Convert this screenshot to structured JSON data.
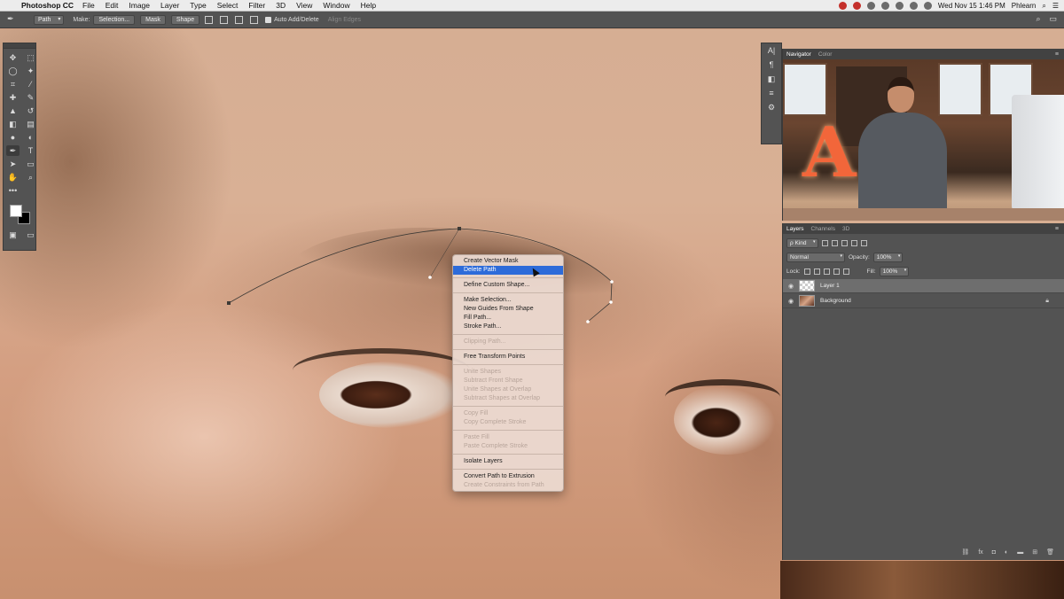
{
  "menubar": {
    "app_name": "Photoshop CC",
    "menus": [
      "File",
      "Edit",
      "Image",
      "Layer",
      "Type",
      "Select",
      "Filter",
      "3D",
      "View",
      "Window",
      "Help"
    ],
    "clock": "Wed Nov 15  1:46 PM",
    "user": "Phlearn"
  },
  "options_bar": {
    "mode": "Path",
    "make_label": "Make:",
    "selection_btn": "Selection...",
    "mask_btn": "Mask",
    "shape_btn": "Shape",
    "auto_add_delete": "Auto Add/Delete",
    "align_edges": "Align Edges"
  },
  "navigator": {
    "tabs": [
      "Navigator",
      "Color"
    ],
    "menu_icon": "panel-menu-icon"
  },
  "layers_panel": {
    "tabs": [
      "Layers",
      "Channels",
      "3D"
    ],
    "kind_label": "ρ Kind",
    "blend_mode": "Normal",
    "opacity_label": "Opacity:",
    "opacity_value": "100%",
    "lock_label": "Lock:",
    "fill_label": "Fill:",
    "fill_value": "100%",
    "layers": [
      {
        "name": "Layer 1",
        "selected": true
      },
      {
        "name": "Background",
        "selected": false
      }
    ]
  },
  "context_menu": {
    "items": [
      {
        "label": "Create Vector Mask",
        "disabled": false
      },
      {
        "label": "Delete Path",
        "highlighted": true
      },
      {
        "sep": true
      },
      {
        "label": "Define Custom Shape...",
        "disabled": false
      },
      {
        "sep": true
      },
      {
        "label": "Make Selection...",
        "disabled": false
      },
      {
        "label": "New Guides From Shape",
        "disabled": false
      },
      {
        "label": "Fill Path...",
        "disabled": false
      },
      {
        "label": "Stroke Path...",
        "disabled": false
      },
      {
        "sep": true
      },
      {
        "label": "Clipping Path...",
        "disabled": true
      },
      {
        "sep": true
      },
      {
        "label": "Free Transform Points",
        "disabled": false
      },
      {
        "sep": true
      },
      {
        "label": "Unite Shapes",
        "disabled": true
      },
      {
        "label": "Subtract Front Shape",
        "disabled": true
      },
      {
        "label": "Unite Shapes at Overlap",
        "disabled": true
      },
      {
        "label": "Subtract Shapes at Overlap",
        "disabled": true
      },
      {
        "sep": true
      },
      {
        "label": "Copy Fill",
        "disabled": true
      },
      {
        "label": "Copy Complete Stroke",
        "disabled": true
      },
      {
        "sep": true
      },
      {
        "label": "Paste Fill",
        "disabled": true
      },
      {
        "label": "Paste Complete Stroke",
        "disabled": true
      },
      {
        "sep": true
      },
      {
        "label": "Isolate Layers",
        "disabled": false
      },
      {
        "sep": true
      },
      {
        "label": "Convert Path to Extrusion",
        "disabled": false
      },
      {
        "label": "Create Constraints from Path",
        "disabled": true
      }
    ]
  },
  "colors": {
    "ui_panel": "#535353",
    "highlight": "#2d6bd9"
  }
}
